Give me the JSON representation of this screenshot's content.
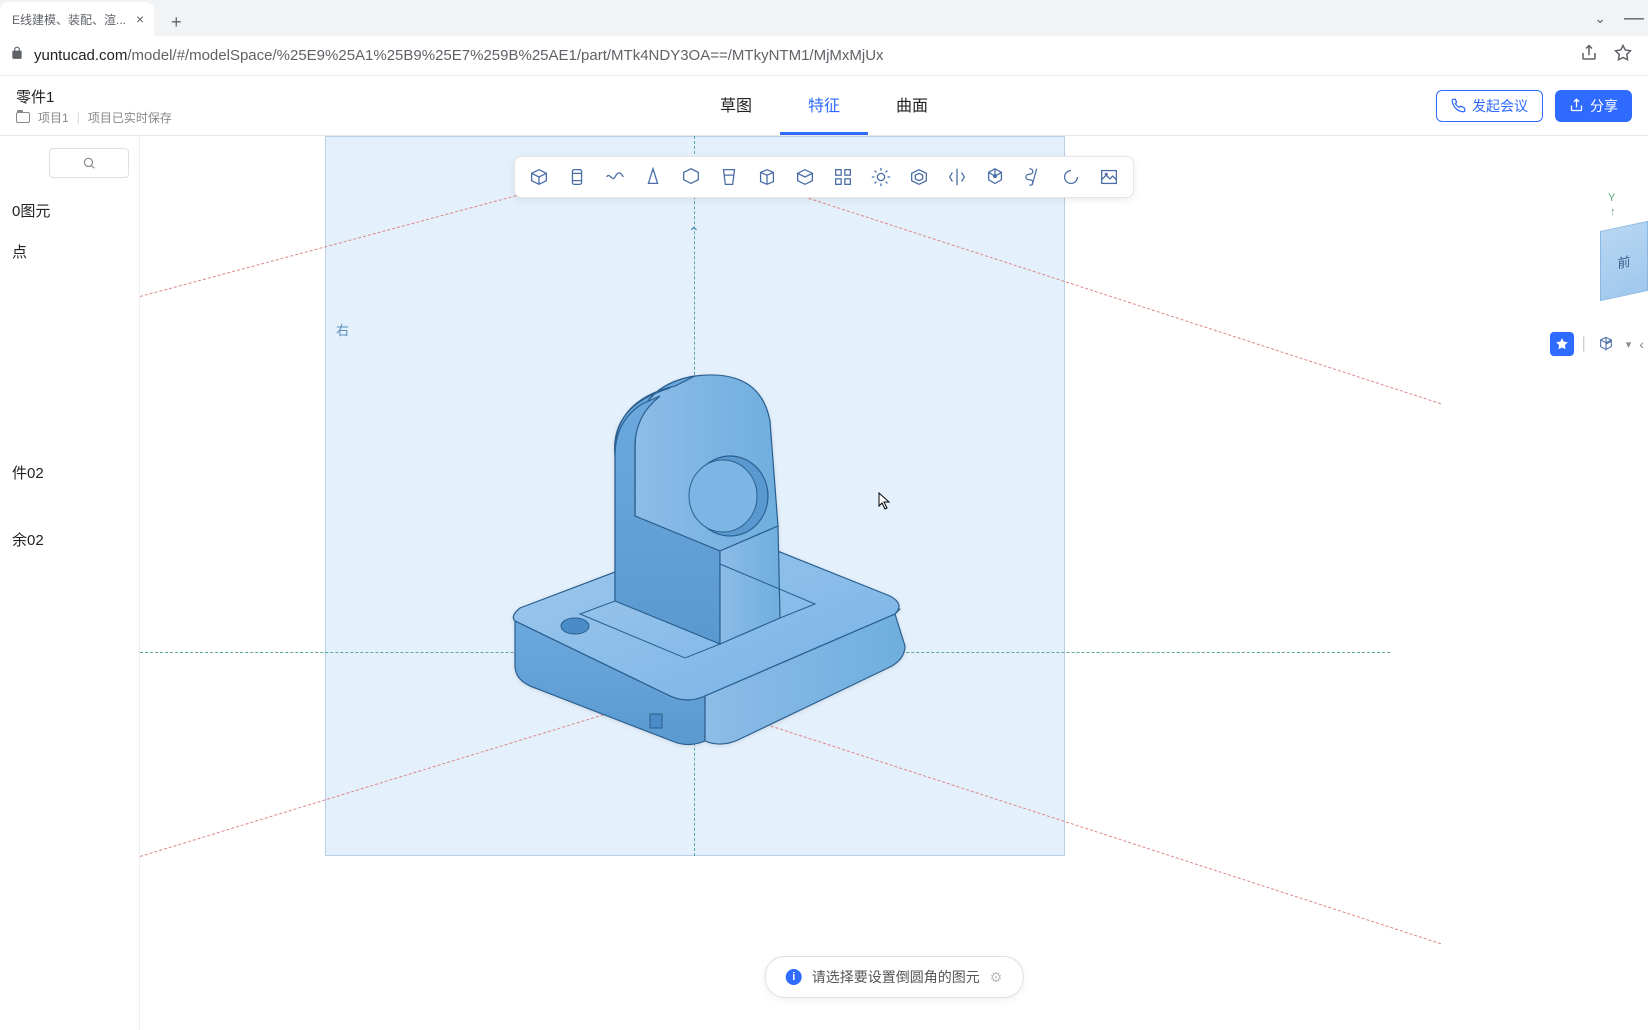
{
  "browser": {
    "tab_title": "E线建模、装配、渲...",
    "url_host": "yuntucad.com",
    "url_path": "/model/#/modelSpace/%25E9%25A1%25B9%25E7%259B%25AE1/part/MTk4NDY3OA==/MTkyNTM1/MjMxMjUx"
  },
  "doc": {
    "title": "零件1",
    "project": "项目1",
    "save_status": "项目已实时保存"
  },
  "mode_tabs": {
    "sketch": "草图",
    "feature": "特征",
    "surface": "曲面",
    "active": "feature"
  },
  "actions": {
    "meeting": "发起会议",
    "share": "分享"
  },
  "sidebar": {
    "items": [
      "0图元",
      "点",
      "",
      "",
      "件02",
      "余02"
    ]
  },
  "toolbar_tools": [
    "extrude",
    "revolve",
    "sweep",
    "loft",
    "shell",
    "draft",
    "box",
    "cylinder",
    "pattern",
    "gear",
    "offset",
    "mirror",
    "array",
    "helix",
    "curve",
    "image"
  ],
  "viewport": {
    "plane_label": "右",
    "axis_y": "Y",
    "cube_face": "前"
  },
  "hint": {
    "text": "请选择要设置倒圆角的图元"
  }
}
